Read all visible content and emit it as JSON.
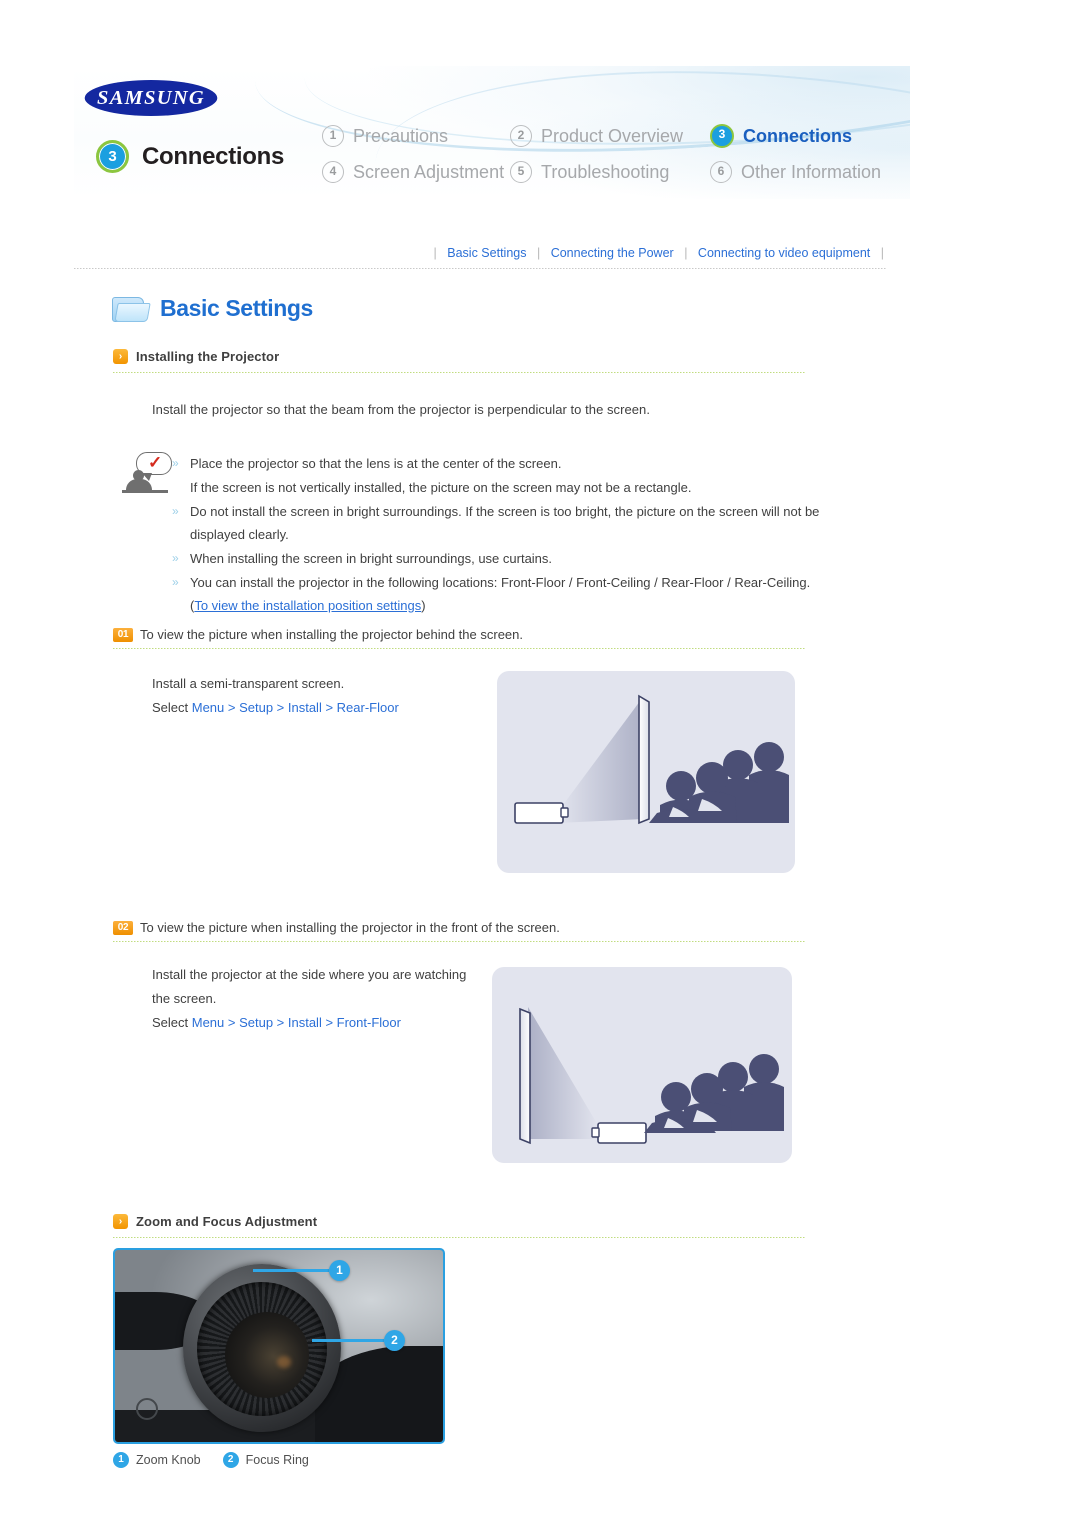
{
  "brand": {
    "logo_text": "SAMSUNG"
  },
  "header": {
    "chapter_number": "3",
    "chapter_label": "Connections",
    "nav_items": [
      {
        "num": "1",
        "label": "Precautions",
        "active": false
      },
      {
        "num": "2",
        "label": "Product Overview",
        "active": false
      },
      {
        "num": "3",
        "label": "Connections",
        "active": true
      },
      {
        "num": "4",
        "label": "Screen Adjustment",
        "active": false
      },
      {
        "num": "5",
        "label": "Troubleshooting",
        "active": false
      },
      {
        "num": "6",
        "label": "Other Information",
        "active": false
      }
    ]
  },
  "subnav": {
    "items": [
      "Basic Settings",
      "Connecting the Power",
      "Connecting to video equipment"
    ]
  },
  "section": {
    "title": "Basic Settings",
    "folder_icon": "folder-icon"
  },
  "installing": {
    "heading": "Installing the Projector",
    "intro": "Install the projector so that the beam from the projector is perpendicular to the screen.",
    "note_icon": "note-person-check-icon",
    "bullets": [
      {
        "marked": true,
        "text": "Place the projector so that the lens is at the center of the screen.",
        "continuation": "If the screen is not vertically installed, the picture on the screen may not be a rectangle."
      },
      {
        "marked": true,
        "text": "Do not install the screen in bright surroundings. If the screen is too bright, the picture on the screen will not be",
        "continuation": "displayed clearly."
      },
      {
        "marked": true,
        "text": "When installing the screen in bright surroundings, use curtains.",
        "continuation": ""
      },
      {
        "marked": true,
        "text": "You can install the projector in the following locations: Front-Floor / Front-Ceiling / Rear-Floor / Rear-Ceiling.",
        "continuation": "",
        "link_prefix": "(",
        "link_text": "To view the installation position settings",
        "link_suffix": ")"
      }
    ]
  },
  "steps": [
    {
      "num": "01",
      "title": "To view the picture when installing the projector behind the screen.",
      "line1": "Install a semi-transparent screen.",
      "select_prefix": "Select ",
      "select_path": "Menu > Setup > Install > Rear-Floor",
      "illustration": "rear-projection-diagram"
    },
    {
      "num": "02",
      "title": "To view the picture when installing the projector in the front of the screen.",
      "line1": "Install the projector at the side where you are watching",
      "line2": "the screen.",
      "select_prefix": "Select ",
      "select_path": "Menu > Setup > Install > Front-Floor",
      "illustration": "front-projection-diagram"
    }
  ],
  "zoom_focus": {
    "heading": "Zoom and Focus Adjustment",
    "photo": "projector-lens-photo",
    "callouts": [
      {
        "num": "1",
        "label": "Zoom Knob"
      },
      {
        "num": "2",
        "label": "Focus Ring"
      }
    ]
  },
  "colors": {
    "link": "#2b6fd6",
    "accent_orange": "#f29400",
    "accent_blue": "#2fa6e6",
    "accent_green": "#8cc63f",
    "samsung_blue": "#1428a0"
  }
}
